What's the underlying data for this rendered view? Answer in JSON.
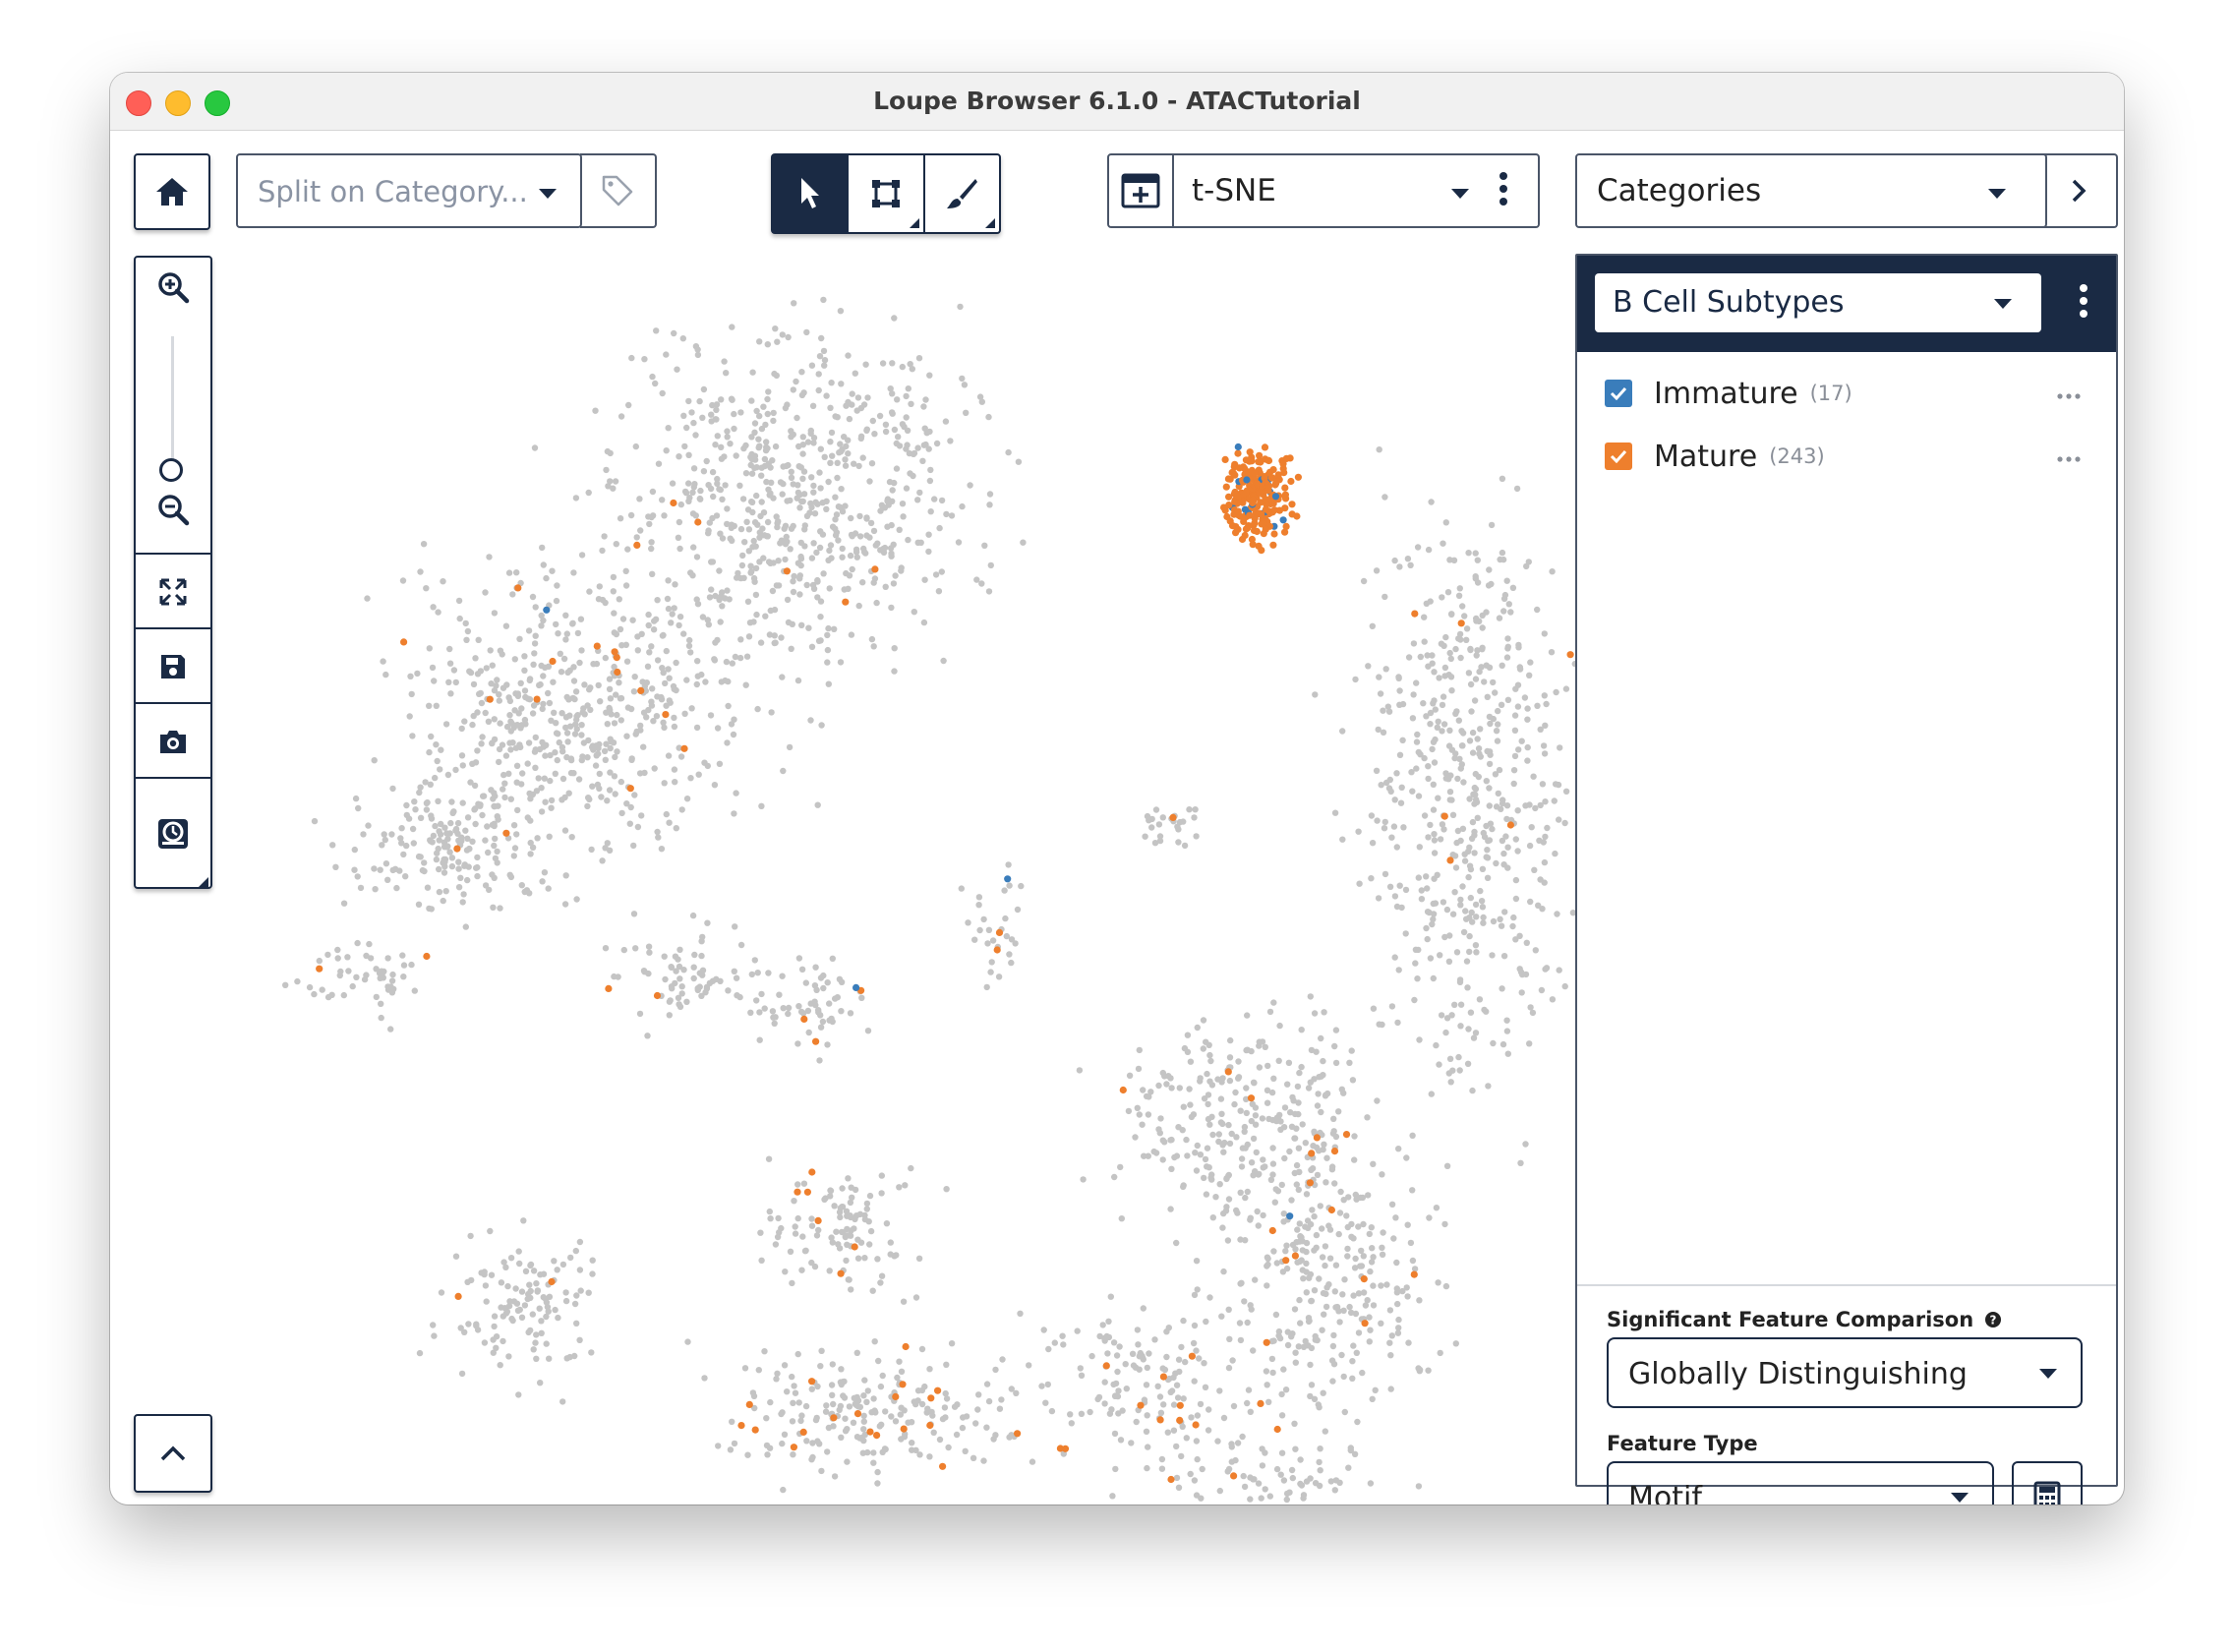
{
  "window": {
    "title": "Loupe Browser 6.1.0 - ATACTutorial"
  },
  "toolbar": {
    "split_placeholder": "Split on Category...",
    "projection": "t-SNE",
    "panel_mode": "Categories"
  },
  "panel": {
    "cluster_selector": "B Cell Subtypes",
    "categories": [
      {
        "name": "Immature",
        "count": "(17)",
        "color": "#3a7dbb",
        "checked": true
      },
      {
        "name": "Mature",
        "count": "(243)",
        "color": "#ee7f2d",
        "checked": true
      }
    ],
    "sig_label": "Significant Feature Comparison",
    "sig_value": "Globally Distinguishing",
    "feature_type_label": "Feature Type",
    "feature_type_value": "Motif"
  },
  "plot": {
    "type": "scatter",
    "background_color": "#c4c4c4",
    "highlight_colors": {
      "Immature": "#3a7dbb",
      "Mature": "#ee7f2d"
    }
  },
  "icons": {
    "window_controls": [
      "close-icon",
      "minimize-icon",
      "zoom-icon"
    ],
    "home": "home-icon",
    "tag": "tag-icon",
    "tools": [
      "pointer-icon",
      "lasso-rect-icon",
      "brush-icon"
    ],
    "projection": "projection-add-icon",
    "more": "more-vertical-icon",
    "next": "chevron-right-icon",
    "sidebar": [
      "zoom-in-icon",
      "zoom-out-icon",
      "fit-view-icon",
      "save-icon",
      "camera-icon",
      "clock-icon"
    ],
    "collapse": "chevron-up-icon",
    "calc": "calculator-icon",
    "help": "help-icon"
  }
}
